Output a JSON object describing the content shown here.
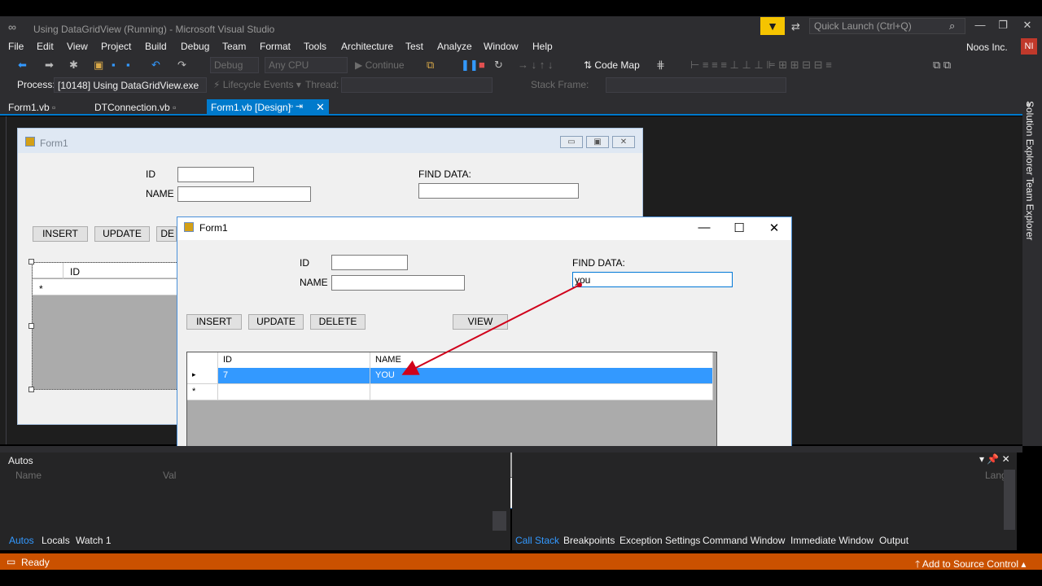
{
  "window": {
    "title": "Using DataGridView (Running) - Microsoft Visual Studio",
    "quick_launch_placeholder": "Quick Launch (Ctrl+Q)",
    "account": "Noos Inc.",
    "account_initials": "NI"
  },
  "menu": [
    "File",
    "Edit",
    "View",
    "Project",
    "Build",
    "Debug",
    "Team",
    "Format",
    "Tools",
    "Architecture",
    "Test",
    "Analyze",
    "Window",
    "Help"
  ],
  "toolbar": {
    "config": "Debug",
    "platform": "Any CPU",
    "continue": "Continue",
    "code_map": "Code Map",
    "process_label": "Process:",
    "process_value": "[10148] Using DataGridView.exe",
    "lifecycle": "Lifecycle Events",
    "thread_label": "Thread:",
    "stack_frame_label": "Stack Frame:"
  },
  "tabs": [
    {
      "label": "Form1.vb"
    },
    {
      "label": "DTConnection.vb"
    },
    {
      "label": "Form1.vb [Design]",
      "active": true
    }
  ],
  "side_tabs": [
    "Solution Explorer",
    "Team Explorer"
  ],
  "design_form": {
    "title": "Form1",
    "id_label": "ID",
    "name_label": "NAME",
    "find_label": "FIND DATA:",
    "insert": "INSERT",
    "update": "UPDATE",
    "delete_partial": "DE",
    "grid_header": "ID",
    "new_row_marker": "*"
  },
  "running_form": {
    "title": "Form1",
    "id_label": "ID",
    "name_label": "NAME",
    "find_label": "FIND DATA:",
    "find_value": "you",
    "insert": "INSERT",
    "update": "UPDATE",
    "delete": "DELETE",
    "view": "VIEW",
    "grid": {
      "columns": [
        "ID",
        "NAME"
      ],
      "rows": [
        {
          "marker": "▸",
          "id": "7",
          "name": "YOU",
          "selected": true
        },
        {
          "marker": "*",
          "id": "",
          "name": "",
          "selected": false
        }
      ]
    }
  },
  "autos_panel": {
    "title": "Autos",
    "col_name": "Name",
    "col_value": "Val",
    "lang_col": "Lang"
  },
  "bottom_tabs_left": [
    {
      "label": "Autos",
      "active": true
    },
    {
      "label": "Locals"
    },
    {
      "label": "Watch 1"
    }
  ],
  "bottom_tabs_right": [
    {
      "label": "Call Stack",
      "active": true
    },
    {
      "label": "Breakpoints"
    },
    {
      "label": "Exception Settings"
    },
    {
      "label": "Command Window"
    },
    {
      "label": "Immediate Window"
    },
    {
      "label": "Output"
    }
  ],
  "status": {
    "text": "Ready",
    "source_control": "Add to Source Control"
  },
  "colors": {
    "accent": "#007acc",
    "status_bar": "#ca5100",
    "selection": "#3399ff",
    "annotation_arrow": "#d0021b"
  },
  "icons": [
    "vs-logo-icon",
    "filter-icon",
    "feedback-icon",
    "search-icon",
    "minimize-icon",
    "maximize-icon",
    "close-icon",
    "pin-icon",
    "up-arrow-icon"
  ]
}
